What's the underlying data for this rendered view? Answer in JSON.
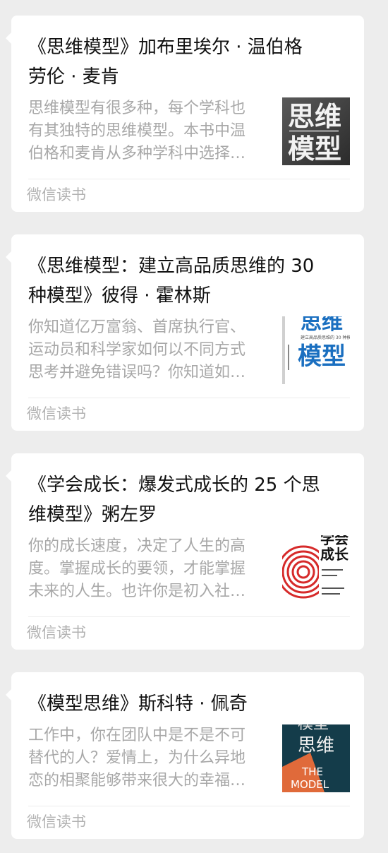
{
  "articles": [
    {
      "title_line1": "《思维模型》加布里埃尔 · 温伯格",
      "title_line2": "劳伦 · 麦肯",
      "desc_line1": "思维模型有很多种，每个学科也",
      "desc_line2": "有其独特的思维模型。本书中温",
      "desc_line3": "伯格和麦肯从多种学科中选择…",
      "source": "微信读书",
      "cover": {
        "line1": "思维",
        "line2": "模型",
        "icon": "book-cover-icon"
      }
    },
    {
      "title_line1": "《思维模型：建立高品质思维的 30",
      "title_line2": "种模型》彼得 · 霍林斯",
      "desc_line1": "你知道亿万富翁、首席执行官、",
      "desc_line2": "运动员和科学家如何以不同方式",
      "desc_line3": "思考并避免错误吗？你知道如…",
      "source": "微信读书",
      "cover": {
        "line1": "思维",
        "line2": "模型",
        "subtitle": "建立高品质思维的 30 种模型",
        "icon": "book-cover-icon"
      }
    },
    {
      "title_line1": "《学会成长：爆发式成长的 25 个思",
      "title_line2": "维模型》粥左罗",
      "desc_line1": "你的成长速度，决定了人生的高",
      "desc_line2": "度。掌握成长的要领，才能掌握",
      "desc_line3": "未来的人生。也许你是初入社…",
      "source": "微信读书",
      "cover": {
        "line1": "学会",
        "line2": "成长",
        "icon": "book-cover-icon"
      }
    },
    {
      "title_line1": "《模型思维》斯科特 · 佩奇",
      "title_line2": "",
      "desc_line1": "工作中，你在团队中是不是不可",
      "desc_line2": "替代的人？爱情上，为什么异地",
      "desc_line3": "恋的相聚能够带来很大的幸福…",
      "source": "微信读书",
      "cover": {
        "line1": "模型",
        "line2": "思维",
        "en1": "THE",
        "en2": "MODEL",
        "icon": "book-cover-icon"
      }
    }
  ],
  "colors": {
    "background": "#ededed",
    "card": "#ffffff",
    "title": "#111111",
    "desc": "#a8a8a8",
    "source": "#b2b2b2"
  }
}
